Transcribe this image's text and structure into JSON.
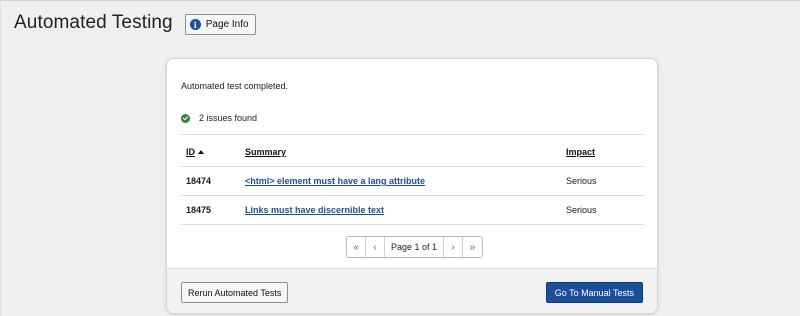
{
  "header": {
    "title": "Automated Testing",
    "page_info_label": "Page Info"
  },
  "results": {
    "status": "Automated test completed.",
    "issues_found": "2 issues found"
  },
  "table": {
    "columns": [
      "ID",
      "Summary",
      "Impact"
    ],
    "rows": [
      {
        "id": "18474",
        "summary": "<html> element must have a lang attribute",
        "impact": "Serious"
      },
      {
        "id": "18475",
        "summary": "Links must have discernible text",
        "impact": "Serious"
      }
    ]
  },
  "pagination": {
    "first": "«",
    "prev": "‹",
    "label": "Page 1 of 1",
    "next": "›",
    "last": "»"
  },
  "footer": {
    "rerun_label": "Rerun Automated Tests",
    "manual_label": "Go To Manual Tests"
  },
  "colors": {
    "primary": "#1b4f9c",
    "success": "#2e8540",
    "background": "#efefef"
  }
}
